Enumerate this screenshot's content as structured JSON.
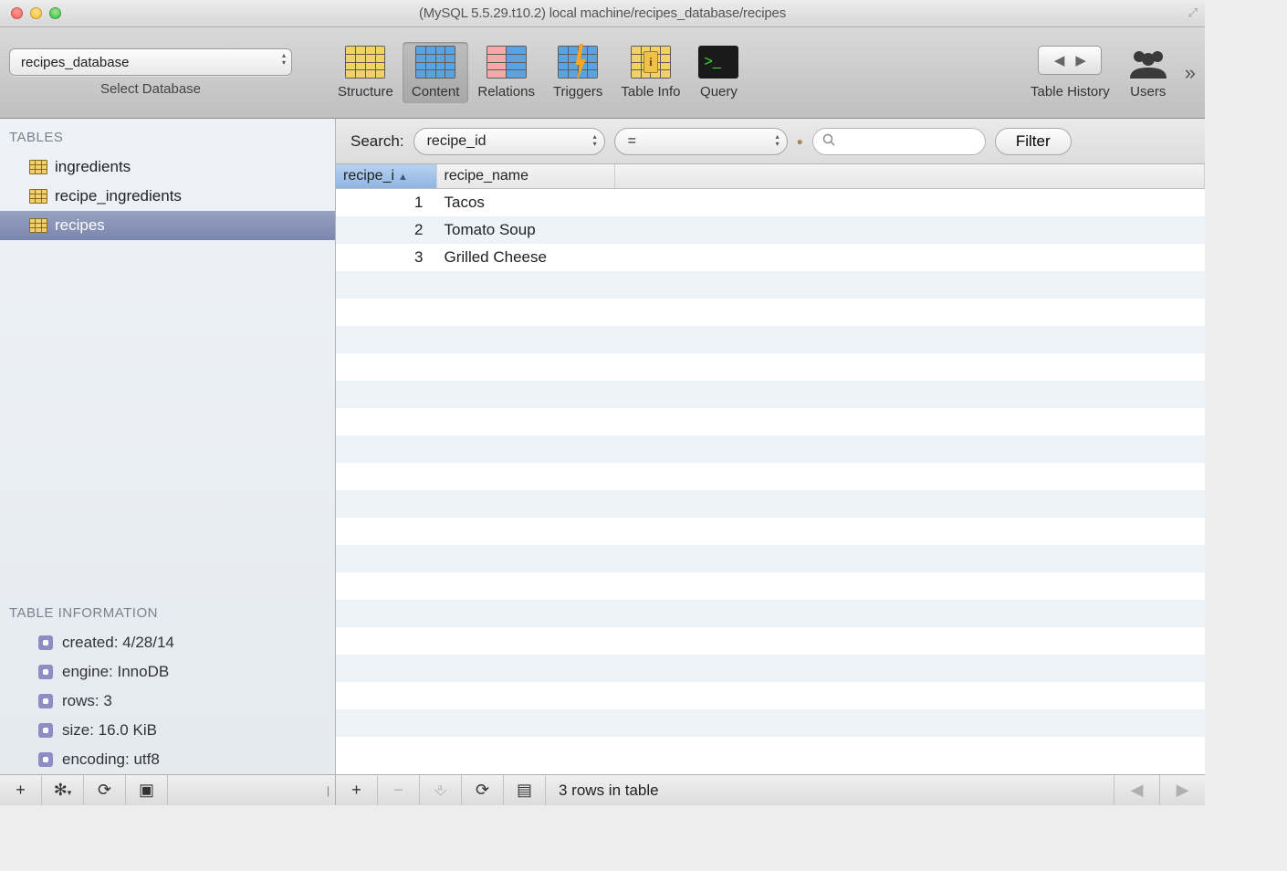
{
  "window": {
    "title": "(MySQL 5.5.29.t10.2) local machine/recipes_database/recipes"
  },
  "toolbar": {
    "database_selector_value": "recipes_database",
    "database_selector_label": "Select Database",
    "items": {
      "structure": "Structure",
      "content": "Content",
      "relations": "Relations",
      "triggers": "Triggers",
      "table_info": "Table Info",
      "query": "Query",
      "table_history": "Table History",
      "users": "Users"
    }
  },
  "sidebar": {
    "header": "TABLES",
    "tables": [
      {
        "name": "ingredients",
        "selected": false
      },
      {
        "name": "recipe_ingredients",
        "selected": false
      },
      {
        "name": "recipes",
        "selected": true
      }
    ],
    "info_header": "TABLE INFORMATION",
    "info": [
      {
        "label": "created",
        "value": "4/28/14"
      },
      {
        "label": "engine",
        "value": "InnoDB"
      },
      {
        "label": "rows",
        "value": "3"
      },
      {
        "label": "size",
        "value": "16.0 KiB"
      },
      {
        "label": "encoding",
        "value": "utf8"
      }
    ]
  },
  "search": {
    "label": "Search:",
    "field_select": "recipe_id",
    "operator": "=",
    "placeholder": "",
    "filter_button": "Filter"
  },
  "columns": [
    {
      "name": "recipe_i",
      "sorted": true
    },
    {
      "name": "recipe_name",
      "sorted": false
    }
  ],
  "rows": [
    {
      "recipe_id": "1",
      "recipe_name": "Tacos"
    },
    {
      "recipe_id": "2",
      "recipe_name": "Tomato Soup"
    },
    {
      "recipe_id": "3",
      "recipe_name": "Grilled Cheese"
    }
  ],
  "status": {
    "row_count_text": "3 rows in table"
  }
}
